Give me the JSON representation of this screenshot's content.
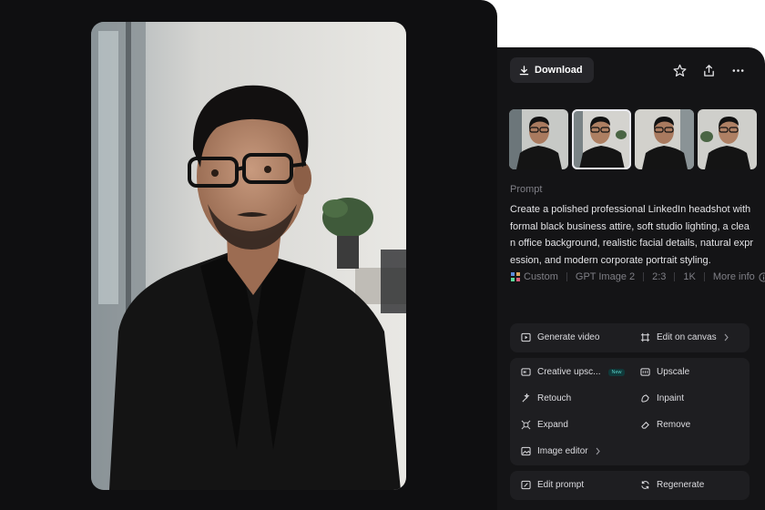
{
  "toolbar": {
    "download_label": "Download",
    "favorite_icon": "star-icon",
    "share_icon": "share-icon",
    "more_icon": "more-icon"
  },
  "thumbnails": [
    {
      "label": "variation-1",
      "selected": false
    },
    {
      "label": "variation-2",
      "selected": true
    },
    {
      "label": "variation-3",
      "selected": false
    },
    {
      "label": "variation-4",
      "selected": false
    }
  ],
  "prompt": {
    "label": "Prompt",
    "text": "Create a polished professional LinkedIn headshot with formal black business attire, soft studio lighting, a clean office background, realistic facial details, natural expression, and modern corporate portrait styling."
  },
  "meta": {
    "style": "Custom",
    "model": "GPT Image 2",
    "ratio": "2:3",
    "resolution": "1K",
    "more_info": "More info"
  },
  "actions": {
    "generate_video": "Generate video",
    "edit_on_canvas": "Edit on canvas",
    "creative_upscale": "Creative upsc...",
    "new_badge": "New",
    "upscale": "Upscale",
    "retouch": "Retouch",
    "inpaint": "Inpaint",
    "expand": "Expand",
    "remove": "Remove",
    "image_editor": "Image editor",
    "edit_prompt": "Edit prompt",
    "regenerate": "Regenerate"
  },
  "colors": {
    "panel_bg": "#141416",
    "card_bg": "#1e1e21",
    "cursor": "#8b7dff"
  }
}
